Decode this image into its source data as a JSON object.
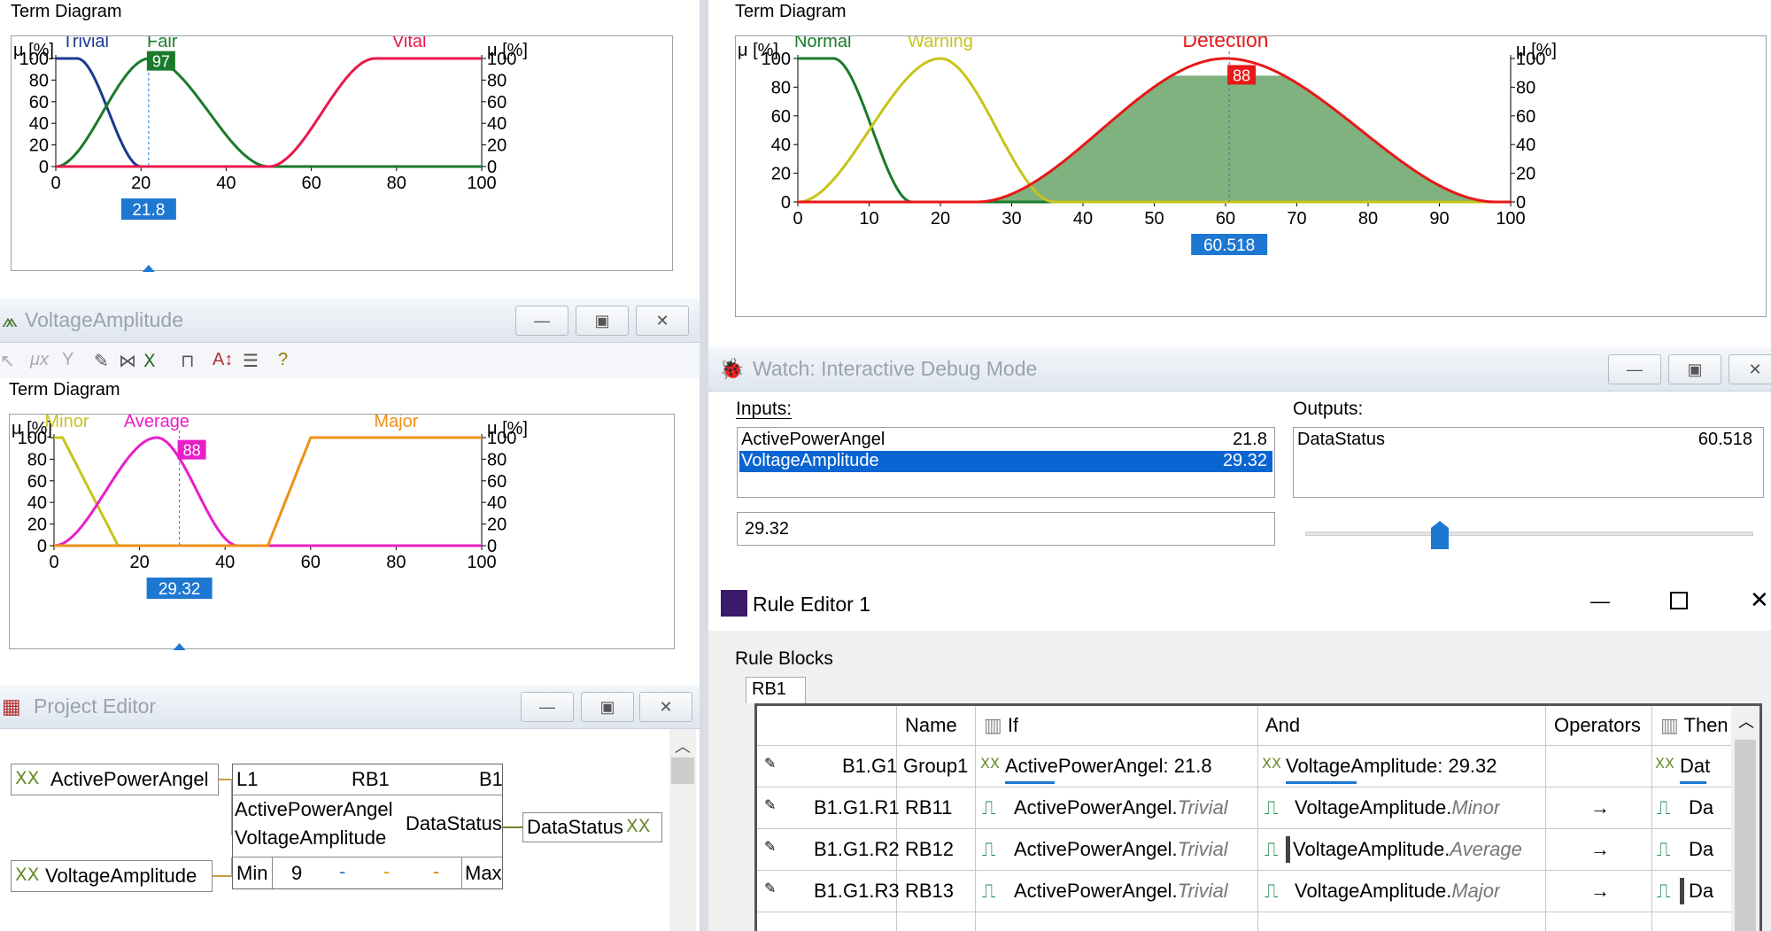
{
  "top_left": {
    "section": "Term Diagram",
    "unit_left": "μ [%]",
    "unit_right": "μ [%]",
    "terms": [
      {
        "name": "Trivial",
        "color": "#1a3a8c"
      },
      {
        "name": "Fair",
        "color": "#1a7a2a"
      },
      {
        "name": "Vital",
        "color": "#e8184a"
      }
    ],
    "active_value": "97",
    "input_value": "21.8",
    "x_ticks": [
      "0",
      "20",
      "40",
      "60",
      "80",
      "100"
    ],
    "y_ticks": [
      "0",
      "20",
      "40",
      "60",
      "80",
      "100"
    ]
  },
  "top_right": {
    "section": "Term Diagram",
    "unit_left": "μ [%]",
    "unit_right": "μ [%]",
    "terms": [
      {
        "name": "Normal",
        "color": "#1a7a2a"
      },
      {
        "name": "Warning",
        "color": "#c8c41a"
      },
      {
        "name": "Detection",
        "color": "#e81818"
      }
    ],
    "active_value": "88",
    "output_value": "60.518",
    "x_ticks": [
      "0",
      "10",
      "20",
      "30",
      "40",
      "50",
      "60",
      "70",
      "80",
      "90",
      "100"
    ],
    "y_ticks": [
      "0",
      "20",
      "40",
      "60",
      "80",
      "100"
    ]
  },
  "voltage_window": {
    "title": "VoltageAmplitude",
    "section": "Term Diagram",
    "unit_left": "μ [%]",
    "unit_right": "μ [%]",
    "terms": [
      {
        "name": "Minor",
        "color": "#c8c41a"
      },
      {
        "name": "Average",
        "color": "#e81ec8"
      },
      {
        "name": "Major",
        "color": "#f0901a"
      }
    ],
    "active_value": "88",
    "input_value": "29.32",
    "x_ticks": [
      "0",
      "20",
      "40",
      "60",
      "80",
      "100"
    ],
    "y_ticks": [
      "0",
      "20",
      "40",
      "60",
      "80",
      "100"
    ],
    "toolbar_icons": [
      "cursor-icon",
      "mu-x-icon",
      "filter-icon",
      "pencil-icon",
      "terms-icon",
      "xx-icon",
      "link-icon",
      "sort-icon",
      "list-icon",
      "help-icon"
    ]
  },
  "watch": {
    "title": "Watch: Interactive Debug Mode",
    "inputs_label": "Inputs:",
    "outputs_label": "Outputs:",
    "inputs": [
      {
        "name": "ActivePowerAngel",
        "value": "21.8"
      },
      {
        "name": "VoltageAmplitude",
        "value": "29.32"
      }
    ],
    "outputs": [
      {
        "name": "DataStatus",
        "value": "60.518"
      }
    ],
    "edit_value": "29.32",
    "slider_fraction": 0.2932
  },
  "project_editor": {
    "title": "Project Editor",
    "input1": "ActivePowerAngel",
    "input2": "VoltageAmplitude",
    "block": {
      "left": "L1",
      "name": "RB1",
      "right": "B1",
      "in1": "ActivePowerAngel",
      "in2": "VoltageAmplitude",
      "out": "DataStatus",
      "min": "Min",
      "count": "9",
      "dash1": "-",
      "dash2": "-",
      "dash3": "-",
      "max": "Max"
    },
    "output": "DataStatus"
  },
  "rule_editor": {
    "title": "Rule Editor 1",
    "rule_blocks_label": "Rule Blocks",
    "tab": "RB1",
    "columns": [
      "Name",
      "If",
      "And",
      "Operators",
      "Then"
    ],
    "group_row": {
      "id": "B1.G1",
      "name": "Group1",
      "if": "ActivePowerAngel: 21.8",
      "and": "VoltageAmplitude: 29.32",
      "then": "Dat"
    },
    "rows": [
      {
        "id": "B1.G1.R1",
        "name": "RB11",
        "if_var": "ActivePowerAngel.",
        "if_term": "Trivial",
        "and_var": "VoltageAmplitude.",
        "and_term": "Minor",
        "op": "→",
        "then": "Da"
      },
      {
        "id": "B1.G1.R2",
        "name": "RB12",
        "if_var": "ActivePowerAngel.",
        "if_term": "Trivial",
        "and_var": "VoltageAmplitude.",
        "and_term": "Average",
        "op": "→",
        "then": "Da"
      },
      {
        "id": "B1.G1.R3",
        "name": "RB13",
        "if_var": "ActivePowerAngel.",
        "if_term": "Trivial",
        "and_var": "VoltageAmplitude.",
        "and_term": "Major",
        "op": "→",
        "then": "Da"
      }
    ]
  },
  "colors": {
    "accent": "#1e78d2",
    "selection": "#0a64d2",
    "fill_green": "#7fb27f"
  }
}
